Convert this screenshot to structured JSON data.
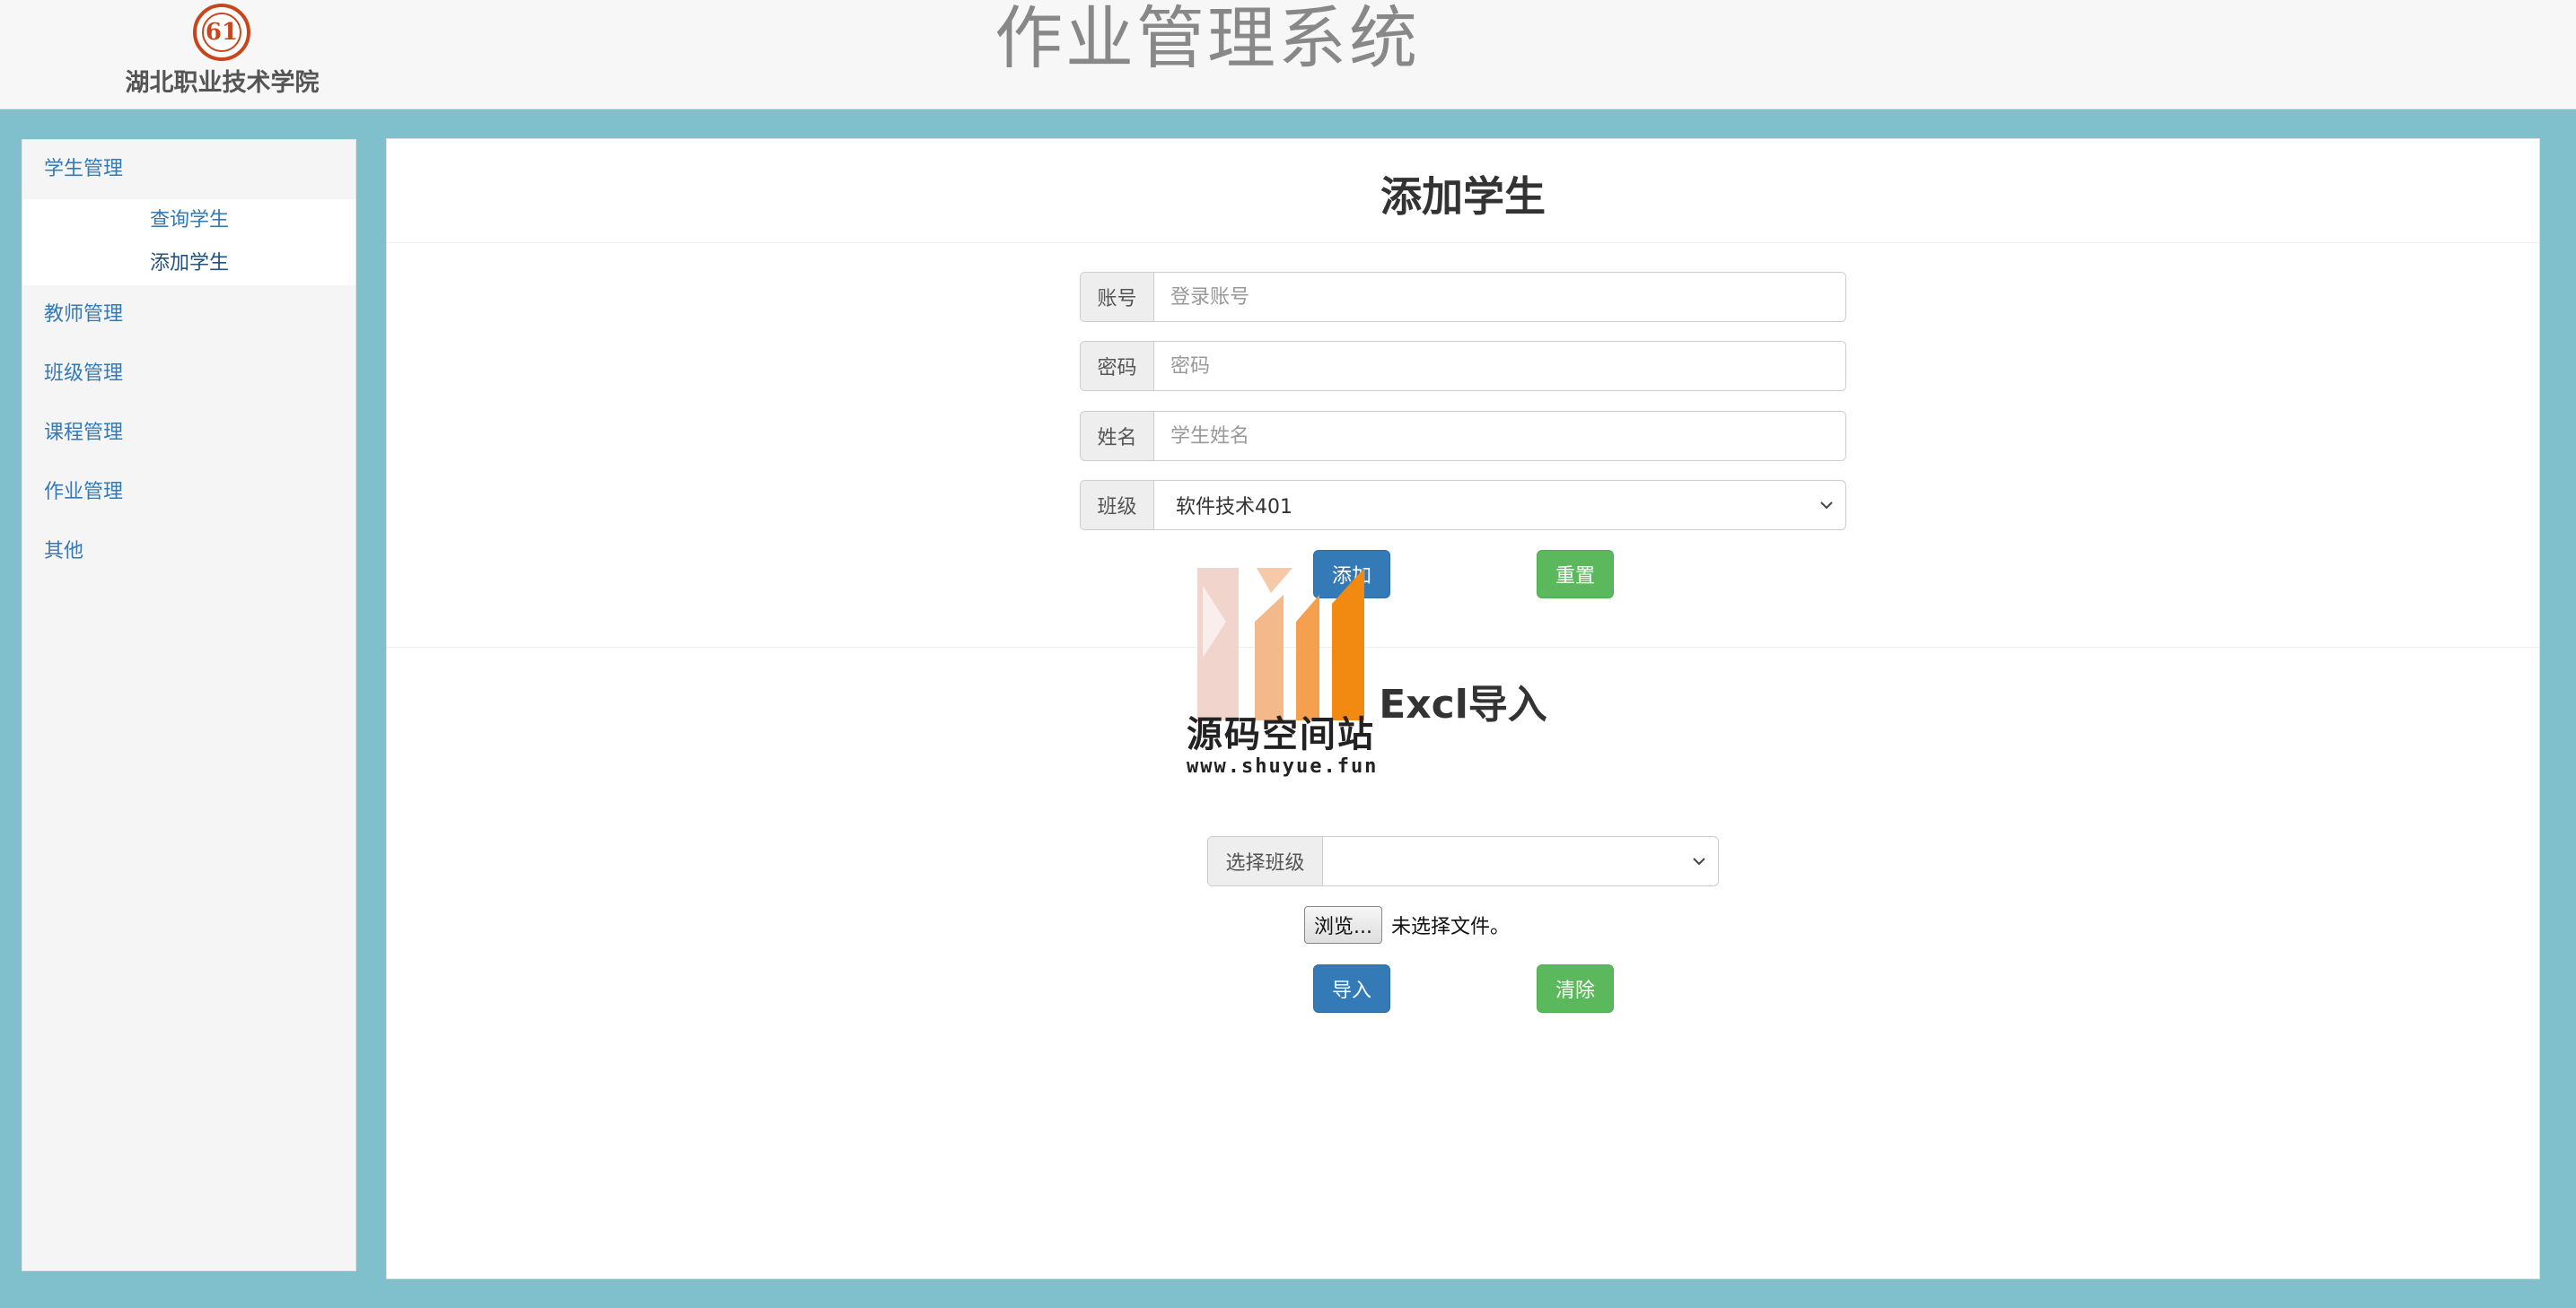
{
  "header": {
    "school_name": "湖北职业技术学院",
    "system_title": "作业管理系统",
    "logo_icon": "school-emblem"
  },
  "sidebar": {
    "groups": [
      {
        "label": "学生管理",
        "items": [
          {
            "label": "查询学生"
          },
          {
            "label": "添加学生",
            "active": true
          }
        ]
      },
      {
        "label": "教师管理"
      },
      {
        "label": "班级管理"
      },
      {
        "label": "课程管理"
      },
      {
        "label": "作业管理"
      },
      {
        "label": "其他"
      }
    ]
  },
  "add_student": {
    "title": "添加学生",
    "account": {
      "label": "账号",
      "placeholder": "登录账号",
      "value": ""
    },
    "password": {
      "label": "密码",
      "placeholder": "密码",
      "value": ""
    },
    "name": {
      "label": "姓名",
      "placeholder": "学生姓名",
      "value": ""
    },
    "class": {
      "label": "班级",
      "selected": "软件技术401"
    },
    "submit_label": "添加",
    "reset_label": "重置"
  },
  "excel_import": {
    "title": "Excl导入",
    "class_select": {
      "label": "选择班级",
      "selected": ""
    },
    "file_button_label": "浏览...",
    "file_status": "未选择文件。",
    "import_label": "导入",
    "clear_label": "清除"
  },
  "watermark": {
    "text": "源码空间站",
    "url": "www.shuyue.fun"
  },
  "colors": {
    "background": "#80c0cc",
    "primary": "#337ab7",
    "success": "#5cb85c",
    "link": "#337ab7",
    "emblem": "#c8461e"
  }
}
